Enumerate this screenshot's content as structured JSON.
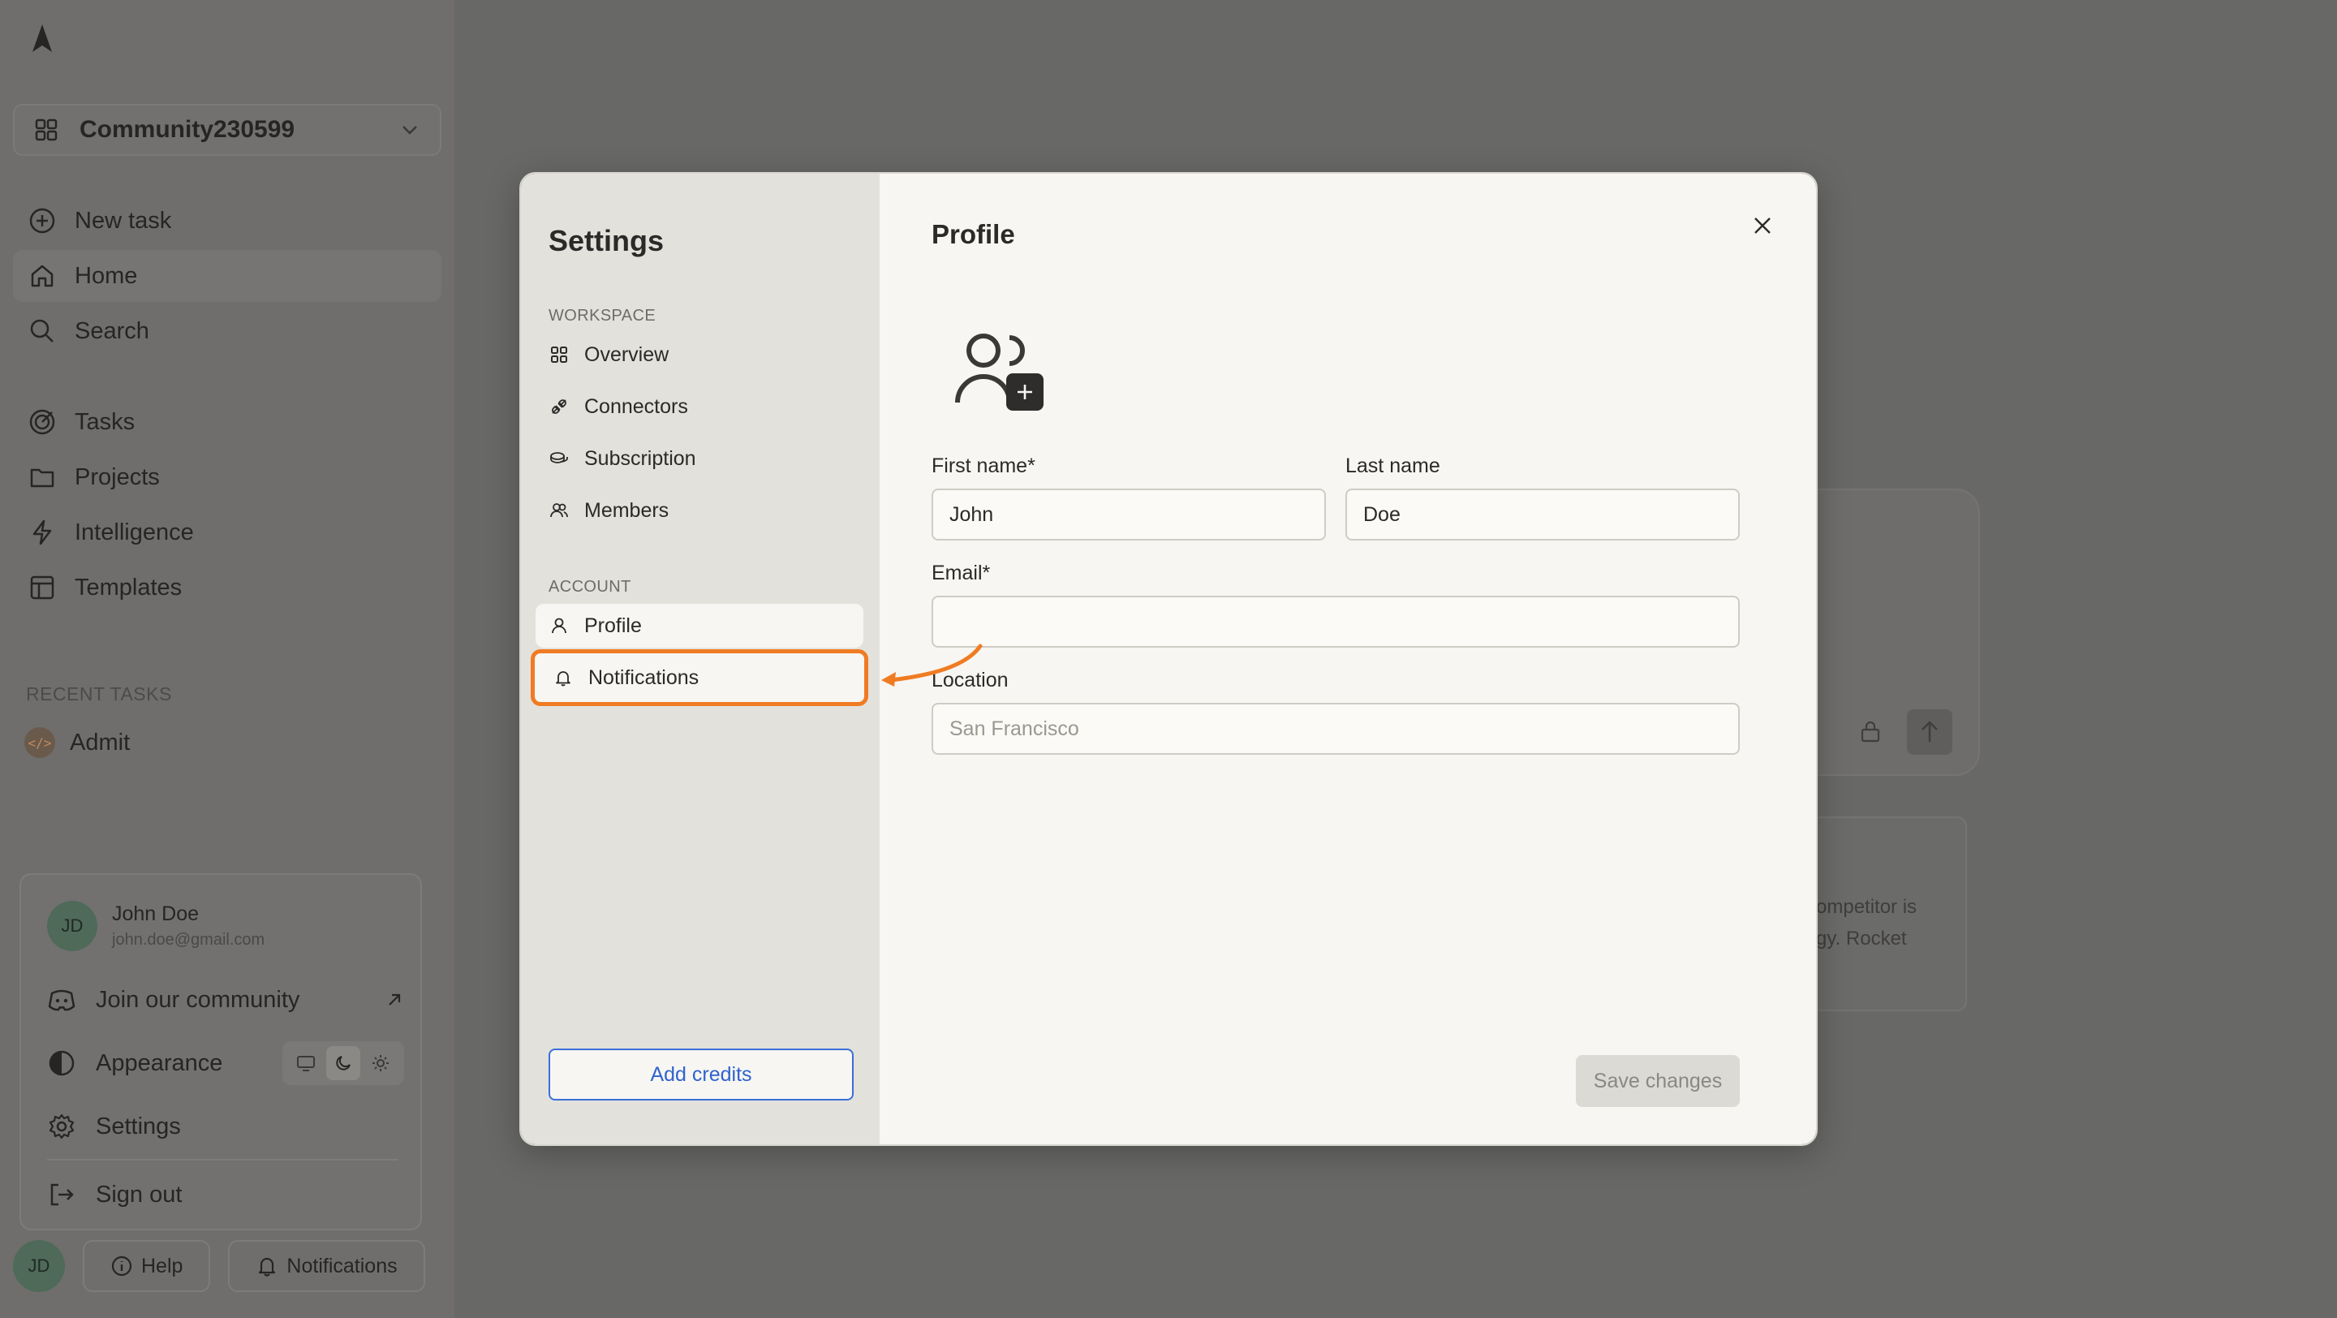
{
  "app": {
    "workspace_name": "Community230599",
    "nav": [
      {
        "label": "New task",
        "icon": "plus-circle-icon"
      },
      {
        "label": "Home",
        "icon": "home-icon"
      },
      {
        "label": "Search",
        "icon": "search-icon"
      },
      {
        "label": "Tasks",
        "icon": "target-icon"
      },
      {
        "label": "Projects",
        "icon": "folder-icon"
      },
      {
        "label": "Intelligence",
        "icon": "bolt-icon"
      },
      {
        "label": "Templates",
        "icon": "layout-icon"
      }
    ],
    "recent_tasks_label": "RECENT TASKS",
    "recent_tasks": [
      {
        "label": "Admit",
        "icon": "code-icon",
        "icon_text": "</>"
      }
    ],
    "user": {
      "initials": "JD",
      "name": "John Doe",
      "email": "john.doe@gmail.com"
    },
    "user_menu": {
      "join": "Join our community",
      "appearance": "Appearance",
      "settings": "Settings",
      "signout": "Sign out"
    },
    "bottom": {
      "initials": "JD",
      "help": "Help",
      "notifications": "Notifications"
    },
    "background_card_text": [
      "ompetitor is",
      "gy. Rocket"
    ]
  },
  "settings": {
    "title": "Settings",
    "workspace_label": "WORKSPACE",
    "workspace_items": [
      "Overview",
      "Connectors",
      "Subscription",
      "Members"
    ],
    "account_label": "ACCOUNT",
    "account_items": [
      "Profile",
      "Notifications"
    ],
    "add_credits": "Add credits",
    "active_item": "Profile",
    "highlighted_item": "Notifications",
    "highlight_color": "#f07b23"
  },
  "profile": {
    "title": "Profile",
    "first_name_label": "First name*",
    "first_name_value": "John",
    "last_name_label": "Last name",
    "last_name_value": "Doe",
    "email_label": "Email*",
    "email_value": "",
    "location_label": "Location",
    "location_placeholder": "San Francisco",
    "save_label": "Save changes"
  }
}
